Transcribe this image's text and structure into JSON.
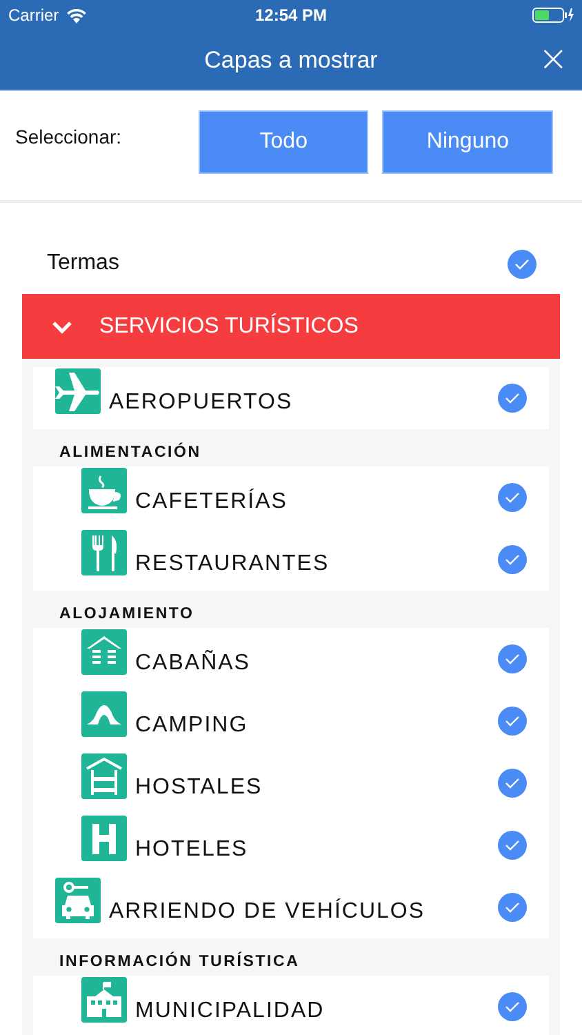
{
  "status_bar": {
    "carrier": "Carrier",
    "time": "12:54 PM"
  },
  "header": {
    "title": "Capas a mostrar",
    "close": "×"
  },
  "select": {
    "label": "Seleccionar:",
    "buttons": [
      "Todo",
      "Ninguno"
    ]
  },
  "layers": [
    {
      "label": "Termas",
      "checked": true
    }
  ],
  "section": {
    "title": "SERVICIOS TURÍSTICOS",
    "expanded": true,
    "groups": [
      {
        "items": [
          {
            "label": "AEROPUERTOS",
            "kind": "item",
            "checked": true
          }
        ]
      },
      {
        "heading": "ALIMENTACIÓN",
        "items": [
          {
            "label": "CAFETERÍAS",
            "kind": "subitem",
            "checked": true
          },
          {
            "label": "RESTAURANTES",
            "kind": "subitem",
            "checked": true
          }
        ]
      },
      {
        "heading": "ALOJAMIENTO",
        "items": [
          {
            "label": "CABAÑAS",
            "kind": "subitem",
            "checked": true
          },
          {
            "label": "CAMPING",
            "kind": "subitem",
            "checked": true
          },
          {
            "label": "HOSTALES",
            "kind": "subitem",
            "checked": true
          },
          {
            "label": "HOTELES",
            "kind": "subitem",
            "checked": true
          },
          {
            "label": "ARRIENDO DE VEHÍCULOS",
            "kind": "item",
            "checked": true
          }
        ]
      },
      {
        "heading": "INFORMACIÓN TURÍSTICA",
        "items": [
          {
            "label": "MUNICIPALIDAD",
            "kind": "subitem",
            "checked": true
          }
        ]
      }
    ]
  }
}
